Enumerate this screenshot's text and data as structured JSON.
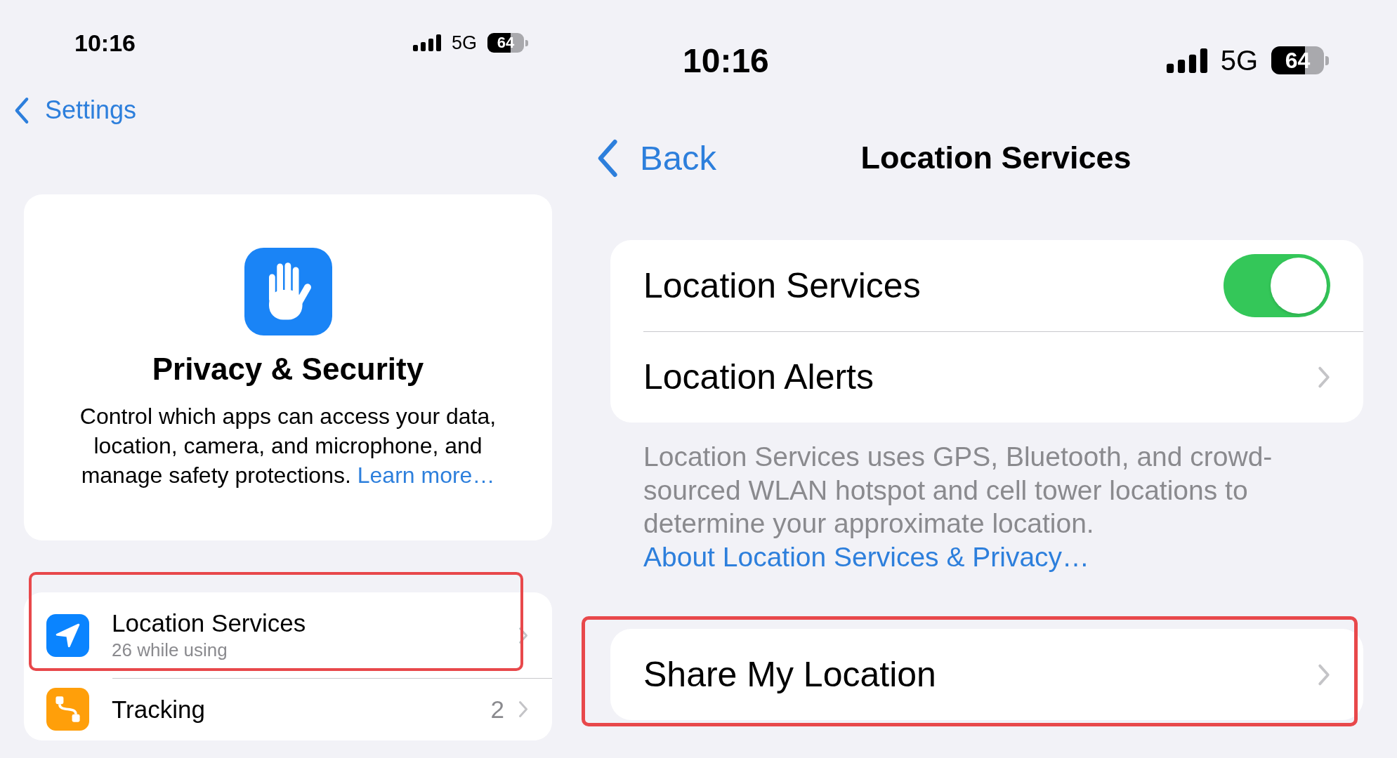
{
  "screens": [
    {
      "status_bar": {
        "time": "10:16",
        "network": "5G",
        "battery": "64"
      },
      "nav": {
        "back": "Settings"
      },
      "header": {
        "title": "Privacy & Security",
        "description": "Control which apps can access your data, location, camera, and microphone, and manage safety protections.",
        "link": "Learn more…"
      },
      "groups": [
        {
          "rows": [
            {
              "kind": "disclosure",
              "label": "Location Services",
              "subtitle": "26 while using",
              "color": "#0a84ff",
              "highlighted": true
            },
            {
              "kind": "disclosure",
              "label": "Tracking",
              "value": "2",
              "color": "#ff9f0a",
              "highlighted": false
            }
          ]
        }
      ]
    },
    {
      "status_bar": {
        "time": "10:16",
        "network": "5G",
        "battery": "64"
      },
      "nav": {
        "back": "Back",
        "title": "Location Services"
      },
      "groups": [
        {
          "rows": [
            {
              "kind": "toggle",
              "label": "Location Services",
              "on": true,
              "highlighted": false
            },
            {
              "kind": "disclosure",
              "label": "Location Alerts",
              "highlighted": false
            }
          ],
          "footer": {
            "text": "Location Services uses GPS, Bluetooth, and crowd-sourced WLAN hotspot and cell tower locations to determine your approximate location.",
            "link": "About Location Services & Privacy…"
          }
        },
        {
          "rows": [
            {
              "kind": "disclosure",
              "label": "Share My Location",
              "highlighted": true
            }
          ]
        }
      ]
    }
  ]
}
